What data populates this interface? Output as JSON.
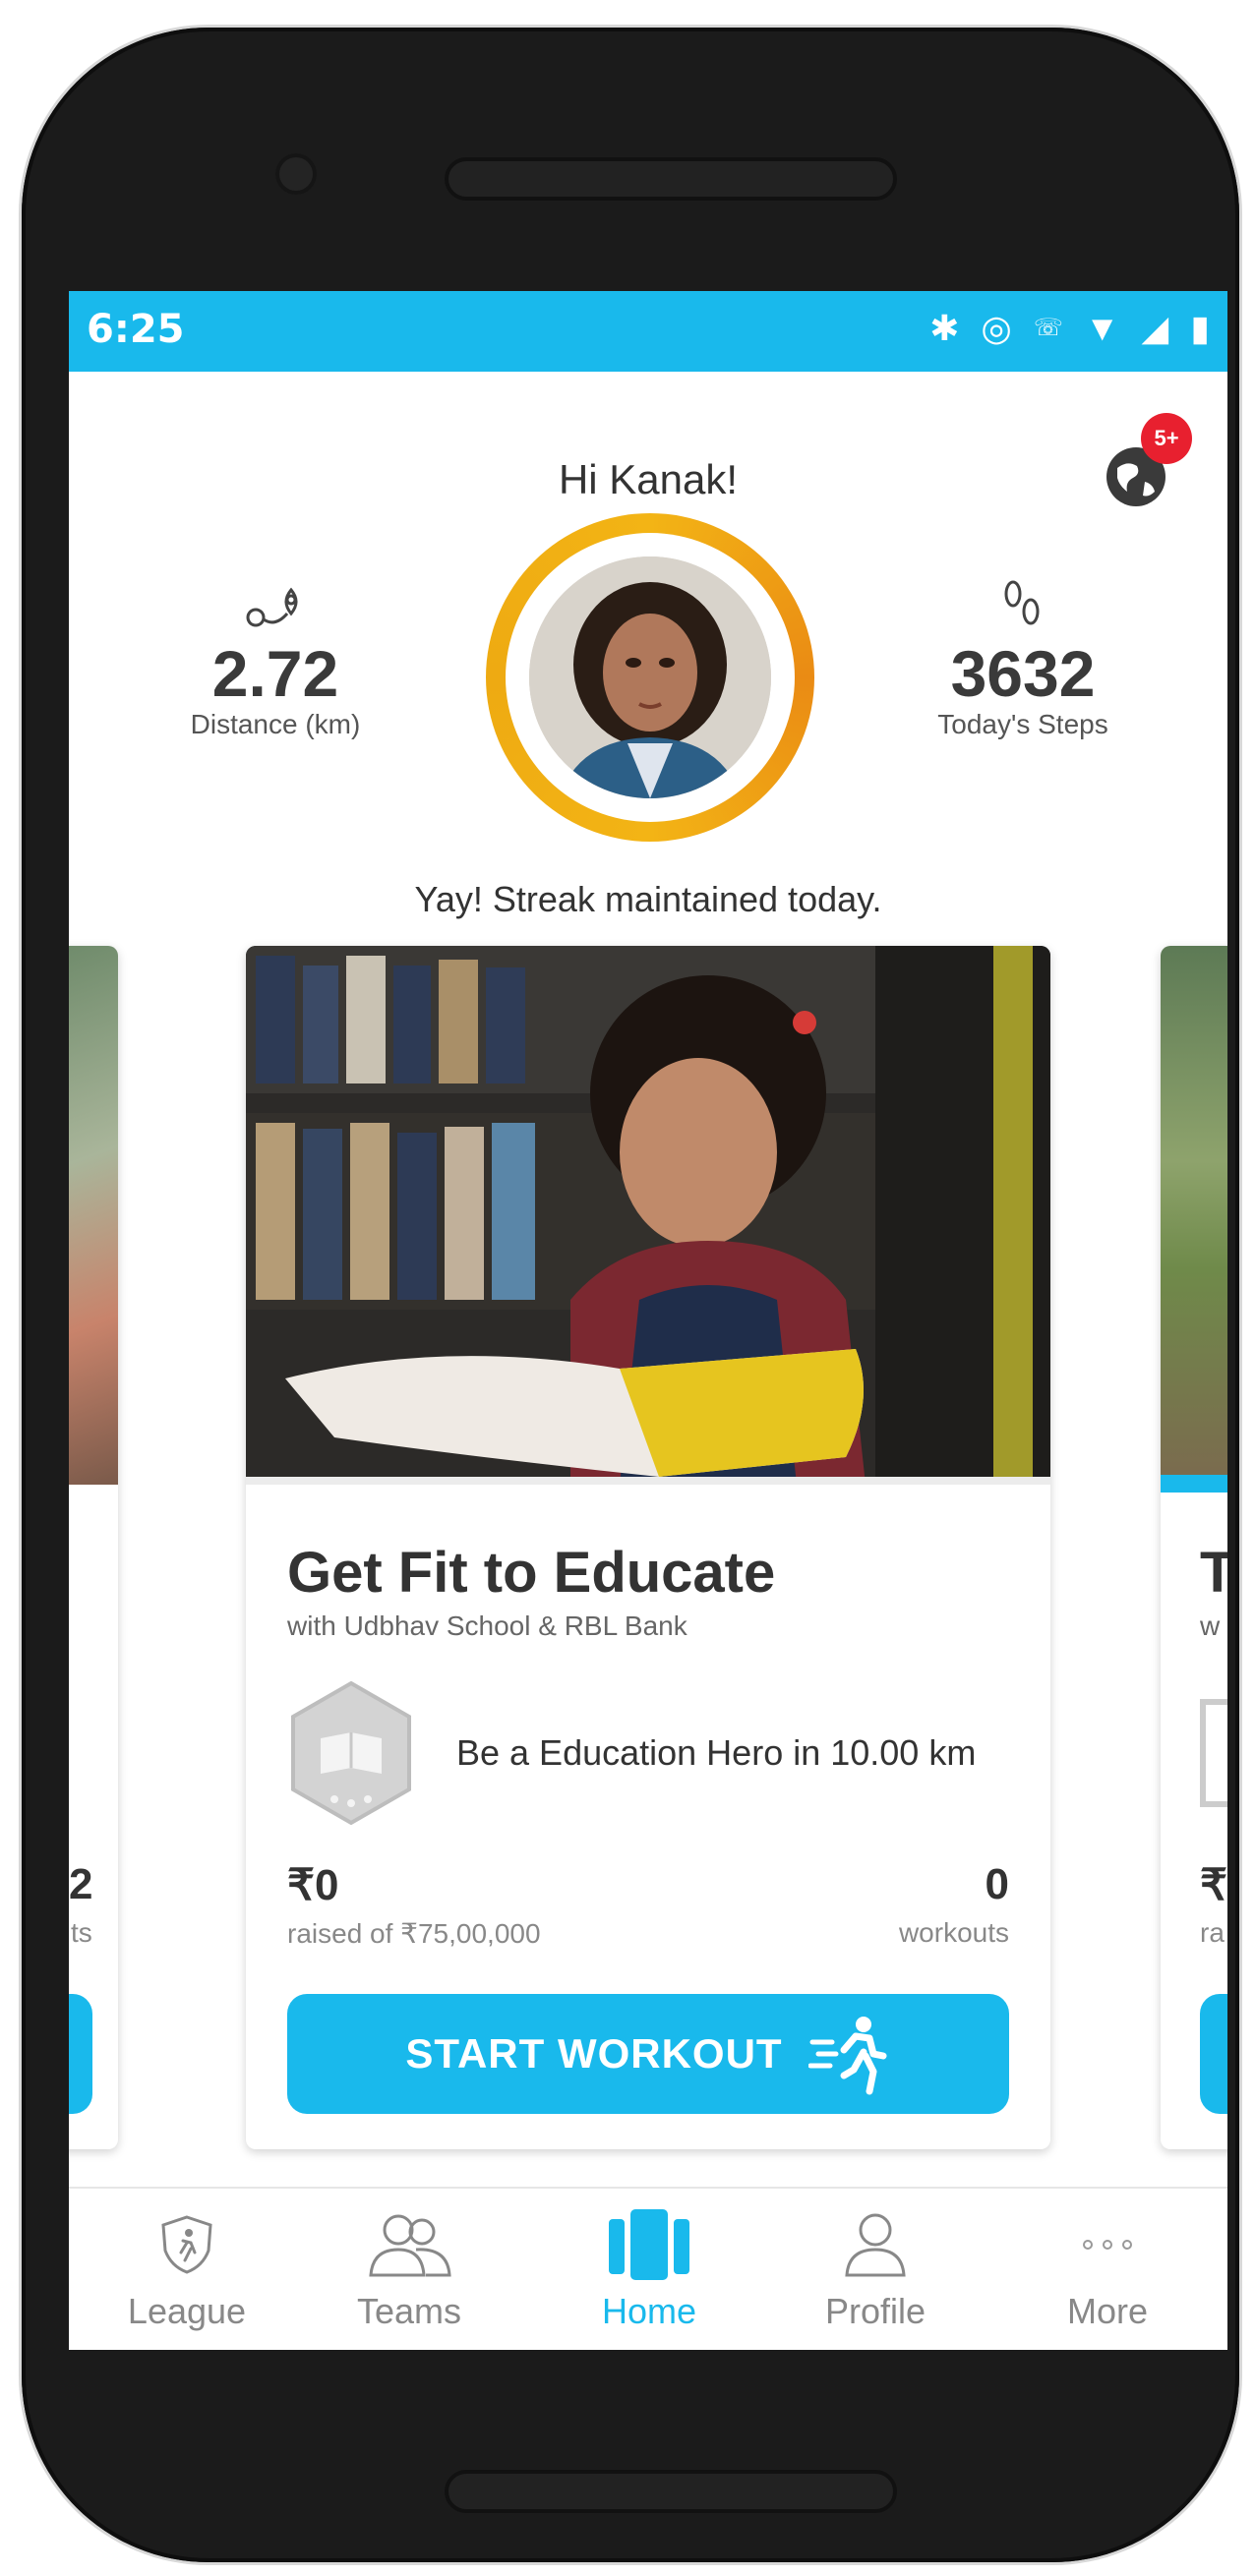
{
  "status_bar": {
    "time": "6:25"
  },
  "header": {
    "greeting": "Hi Kanak!",
    "notification_count": "5+"
  },
  "stats": {
    "distance": {
      "value": "2.72",
      "label": "Distance (km)"
    },
    "steps": {
      "value": "3632",
      "label": "Today's Steps"
    }
  },
  "streak_text": "Yay! Streak maintained today.",
  "campaign": {
    "title": "Get Fit to Educate",
    "subtitle": "with Udbhav School & RBL Bank",
    "hero_text": "Be a Education Hero in 10.00 km",
    "raised_value": "₹0",
    "raised_of": "raised of ₹75,00,000",
    "workouts_value": "0",
    "workouts_label": "workouts",
    "button_label": "START WORKOUT"
  },
  "left_card": {
    "value": "2",
    "label": "ts"
  },
  "right_card": {
    "title": "T",
    "sub": "w",
    "raised": "₹",
    "raised_of": "ra"
  },
  "nav": [
    {
      "label": "League"
    },
    {
      "label": "Teams"
    },
    {
      "label": "Home"
    },
    {
      "label": "Profile"
    },
    {
      "label": "More"
    }
  ],
  "colors": {
    "accent": "#19b9ec",
    "ring": "#f3b415",
    "badge": "#e8202f"
  }
}
